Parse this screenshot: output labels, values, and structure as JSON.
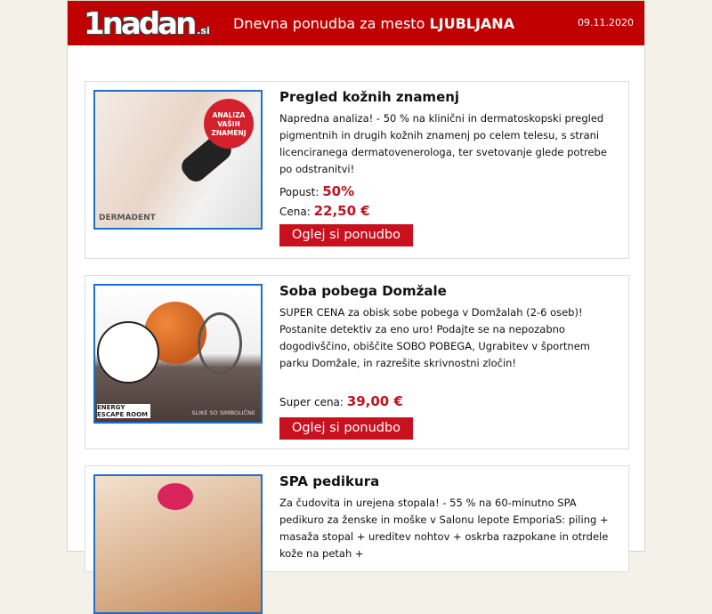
{
  "header": {
    "logo": "1nadan",
    "logo_tld": ".si",
    "title_prefix": "Dnevna ponudba za mesto ",
    "city": "LJUBLJANA",
    "date": "09.11.2020"
  },
  "offers": [
    {
      "title": "Pregled kožnih znamenj",
      "desc": "Napredna analiza! - 50 % na klinični in dermatoskopski pregled pigmentnih in drugih kožnih znamenj po celem telesu, s strani licenciranega dermatovenerologa, ter svetovanje glede potrebe po odstranitvi!",
      "discount_label": "Popust:",
      "discount": "50%",
      "price_label": "Cena:",
      "price": "22,50 €",
      "button": "Oglej si ponudbo",
      "badge": "ANALIZA VAŠIH ZNAMENJ",
      "brand": "DERMADENT"
    },
    {
      "title": "Soba pobega Domžale",
      "desc": "SUPER CENA za obisk sobe pobega v Domžalah (2-6 oseb)! Postanite detektiv za eno uro! Podajte se na nepozabno dogodivščino, obiščite SOBO POBEGA, Ugrabitev v športnem parku Domžale, in razrešite skrivnostni zločin!",
      "price_label": "Super cena:",
      "price": "39,00 €",
      "button": "Oglej si ponudbo",
      "brand": "ENERGY ESCAPE ROOM",
      "caption": "SLIKE SO SIMBOLIČNE"
    },
    {
      "title": "SPA pedikura",
      "desc": "Za čudovita in urejena stopala! - 55 % na 60-minutno SPA pedikuro za ženske in moške v Salonu lepote EmporiaS: piling + masaža stopal + ureditev nohtov + oskrba razpokane in otrdele kože na petah +"
    }
  ],
  "colors": {
    "brand_red": "#c00000",
    "button_red": "#c8101e",
    "image_border": "#1f6fc4"
  }
}
